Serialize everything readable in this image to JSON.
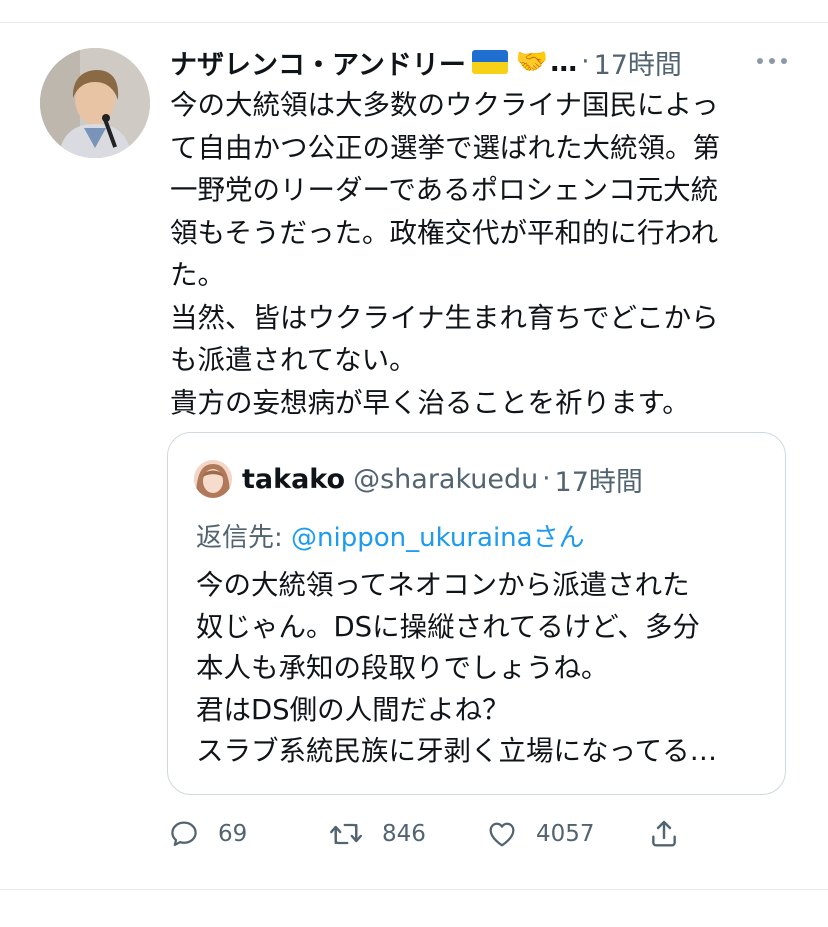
{
  "tweet": {
    "display_name": "ナザレンコ・アンドリー",
    "name_truncation": "…",
    "separator": "·",
    "time": "17時間",
    "more_label": "···",
    "emoji_handshake": "🤝",
    "lines": [
      "今の大統領は大多数のウクライナ国民によっ",
      "て自由かつ公正の選挙で選ばれた大統領。第",
      "一野党のリーダーであるポロシェンコ元大統",
      "領もそうだった。政権交代が平和的に行われ",
      "た。",
      "当然、皆はウクライナ生まれ育ちでどこから",
      "も派遣されてない。",
      "貴方の妄想病が早く治ることを祈ります。"
    ]
  },
  "quote": {
    "name": "takako",
    "handle": "@sharakuedu",
    "separator": "·",
    "time": "17時間",
    "reply_prefix": "返信先: ",
    "reply_mention": "@nippon_ukuraina",
    "reply_suffix": "さん",
    "lines": [
      "今の大統領ってネオコンから派遣された",
      "奴じゃん。DSに操縦されてるけど、多分",
      "本人も承知の段取りでしょうね。",
      "君はDS側の人間だよね？",
      "スラブ系統民族に牙剥く立場になってる…"
    ]
  },
  "actions": {
    "reply_count": "69",
    "retweet_count": "846",
    "like_count": "4057"
  },
  "colors": {
    "text": "#0f1419",
    "secondary": "#536471",
    "link": "#1d9bf0",
    "border": "#cfd9de"
  }
}
